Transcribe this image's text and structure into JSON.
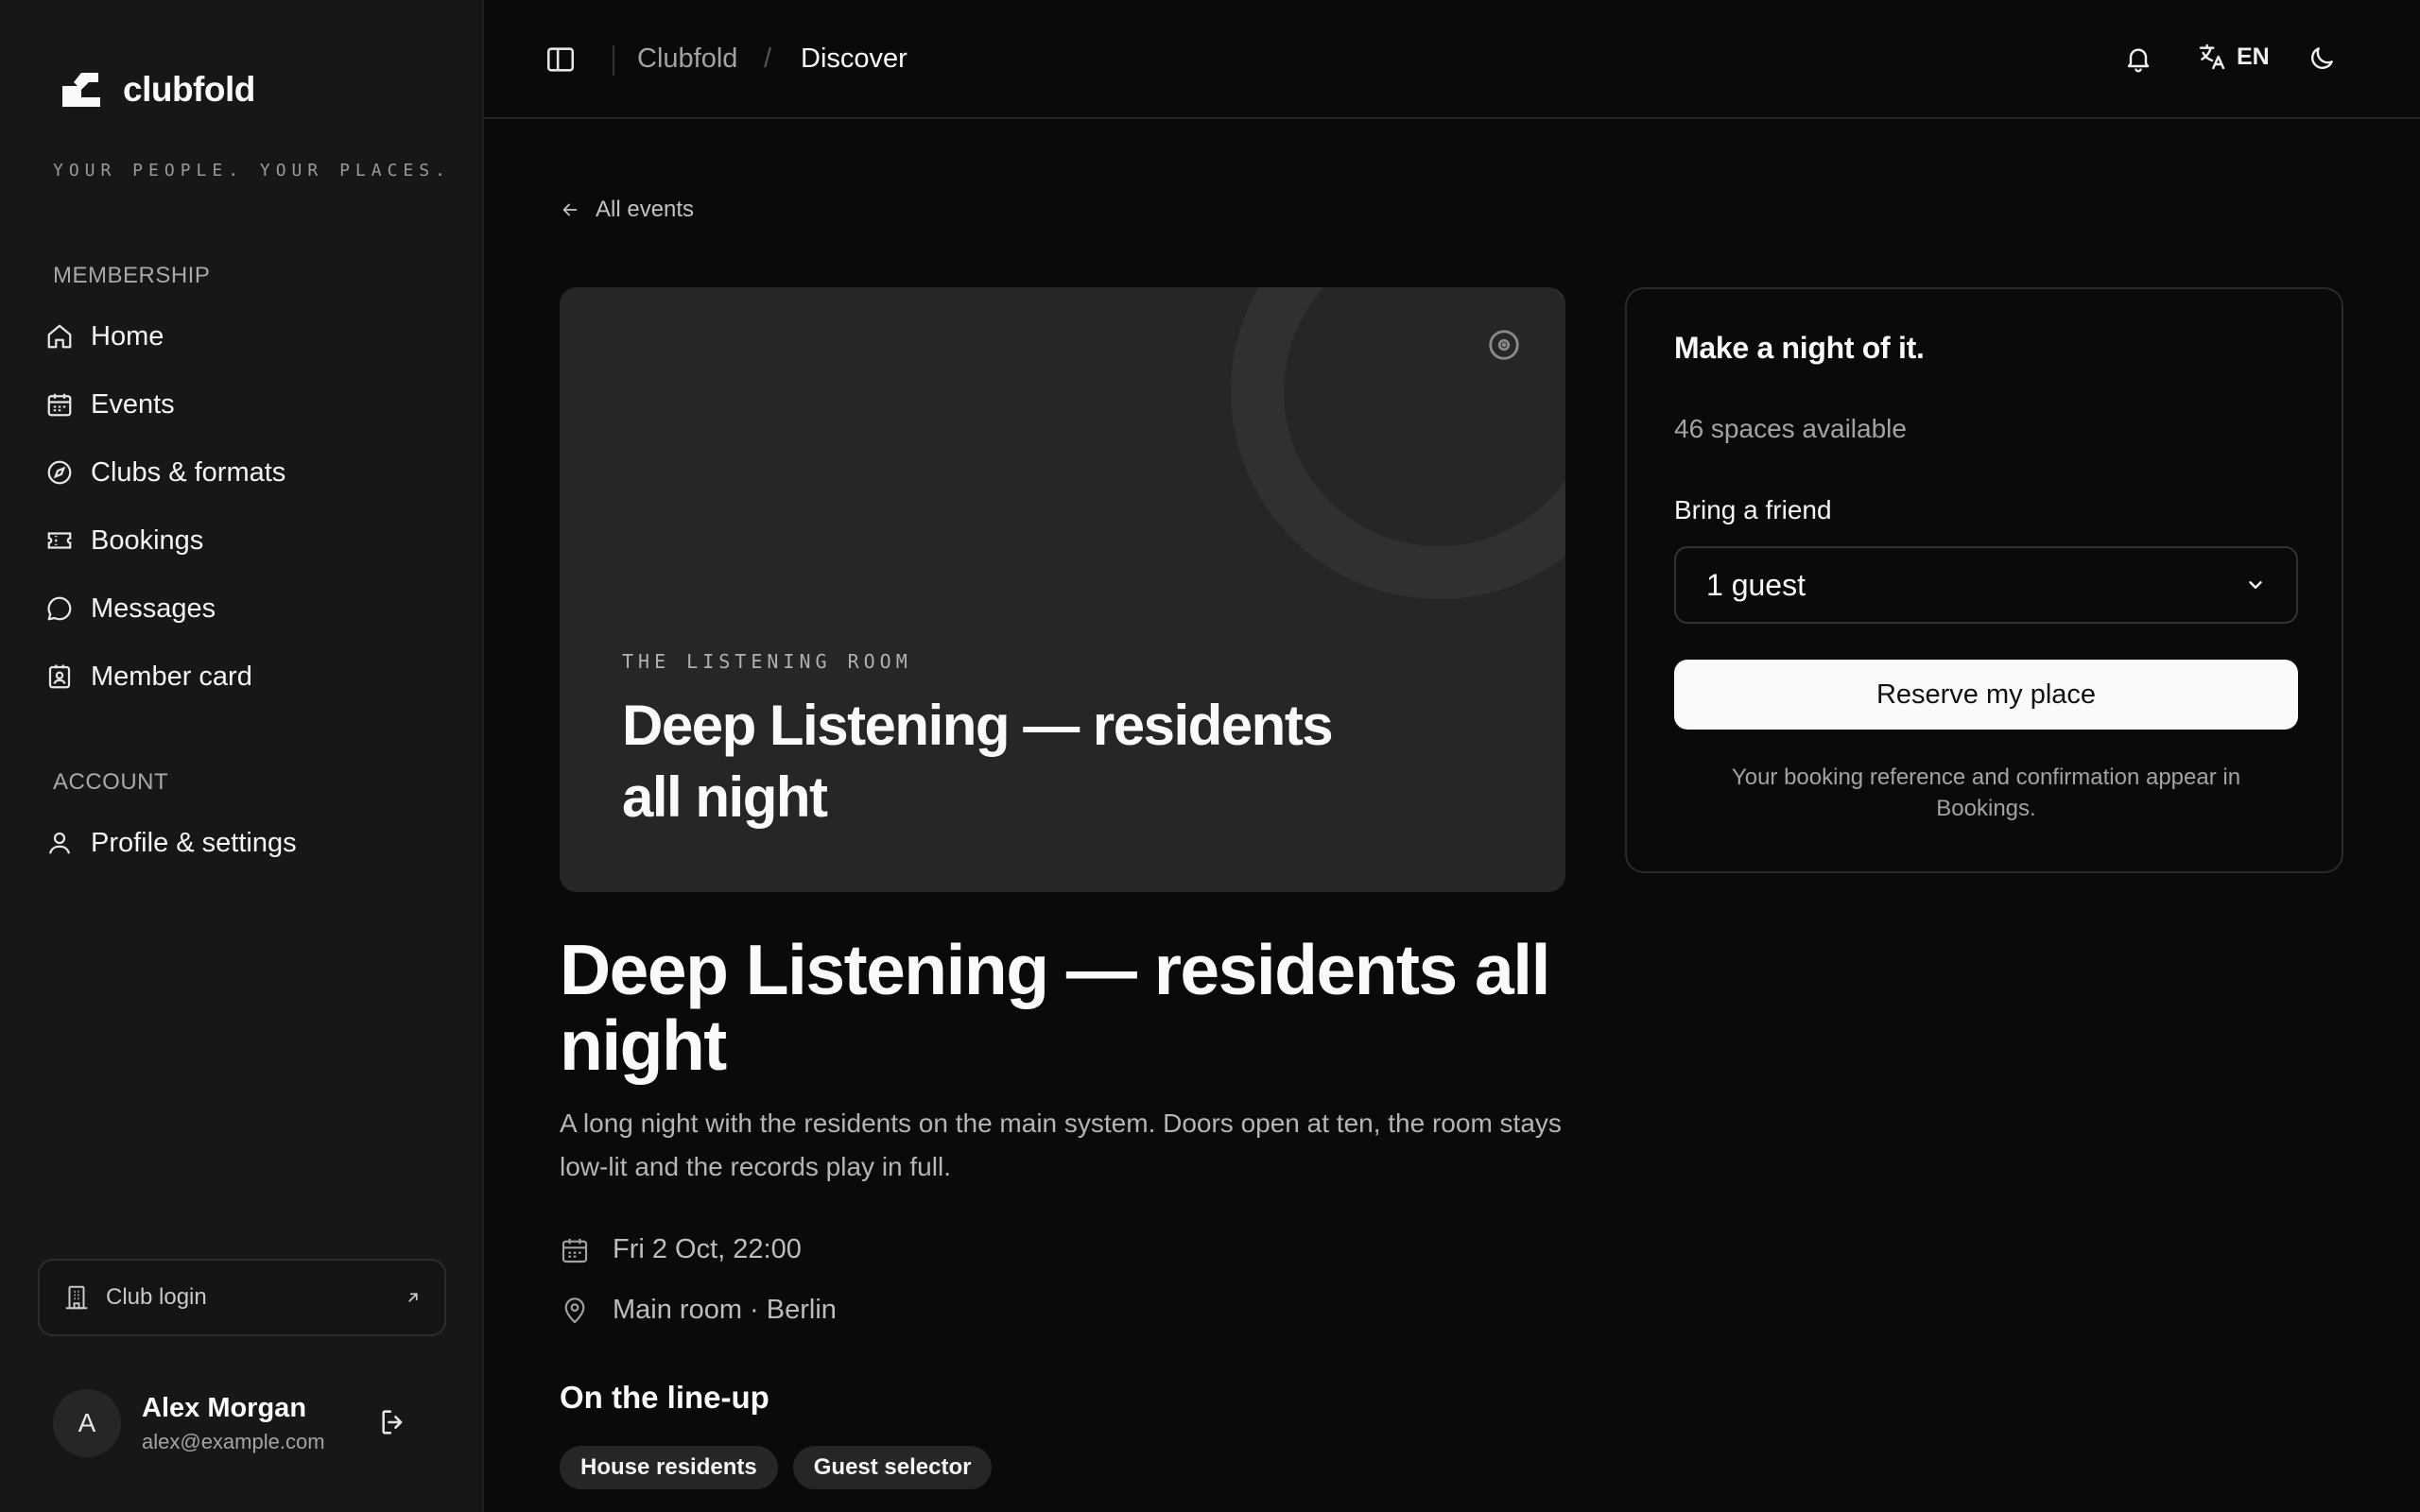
{
  "brand": {
    "name": "clubfold",
    "tagline": "YOUR PEOPLE. YOUR PLACES."
  },
  "sidebar": {
    "membership_label": "MEMBERSHIP",
    "items": [
      {
        "label": "Home",
        "icon": "home-icon"
      },
      {
        "label": "Events",
        "icon": "calendar-icon"
      },
      {
        "label": "Clubs & formats",
        "icon": "compass-icon"
      },
      {
        "label": "Bookings",
        "icon": "ticket-icon"
      },
      {
        "label": "Messages",
        "icon": "message-icon"
      },
      {
        "label": "Member card",
        "icon": "member-card-icon"
      }
    ],
    "account_label": "ACCOUNT",
    "account_items": [
      {
        "label": "Profile & settings",
        "icon": "user-icon"
      }
    ],
    "club_login": "Club login",
    "user": {
      "initial": "A",
      "name": "Alex Morgan",
      "email": "alex@example.com"
    }
  },
  "topbar": {
    "breadcrumb": [
      "Clubfold",
      "Discover"
    ],
    "separator": "/",
    "language": "EN"
  },
  "event": {
    "back_label": "All events",
    "venue_kicker": "THE LISTENING ROOM",
    "hero_title": "Deep Listening — residents all night",
    "title": "Deep Listening — residents all night",
    "description": "A long night with the residents on the main system. Doors open at ten, the room stays low-lit and the records play in full.",
    "datetime": "Fri 2 Oct, 22:00",
    "location": "Main room · Berlin",
    "lineup_heading": "On the line-up",
    "lineup": [
      "House residents",
      "Guest selector"
    ]
  },
  "booking": {
    "title": "Make a night of it.",
    "spaces": "46 spaces available",
    "friend_label": "Bring a friend",
    "guest_selected": "1 guest",
    "reserve_label": "Reserve my place",
    "note": "Your booking reference and confirmation appear in Bookings."
  },
  "colors": {
    "background": "#0a0a0a",
    "sidebar": "#171717",
    "surface": "#262626",
    "primary_button": "#fafafa"
  }
}
